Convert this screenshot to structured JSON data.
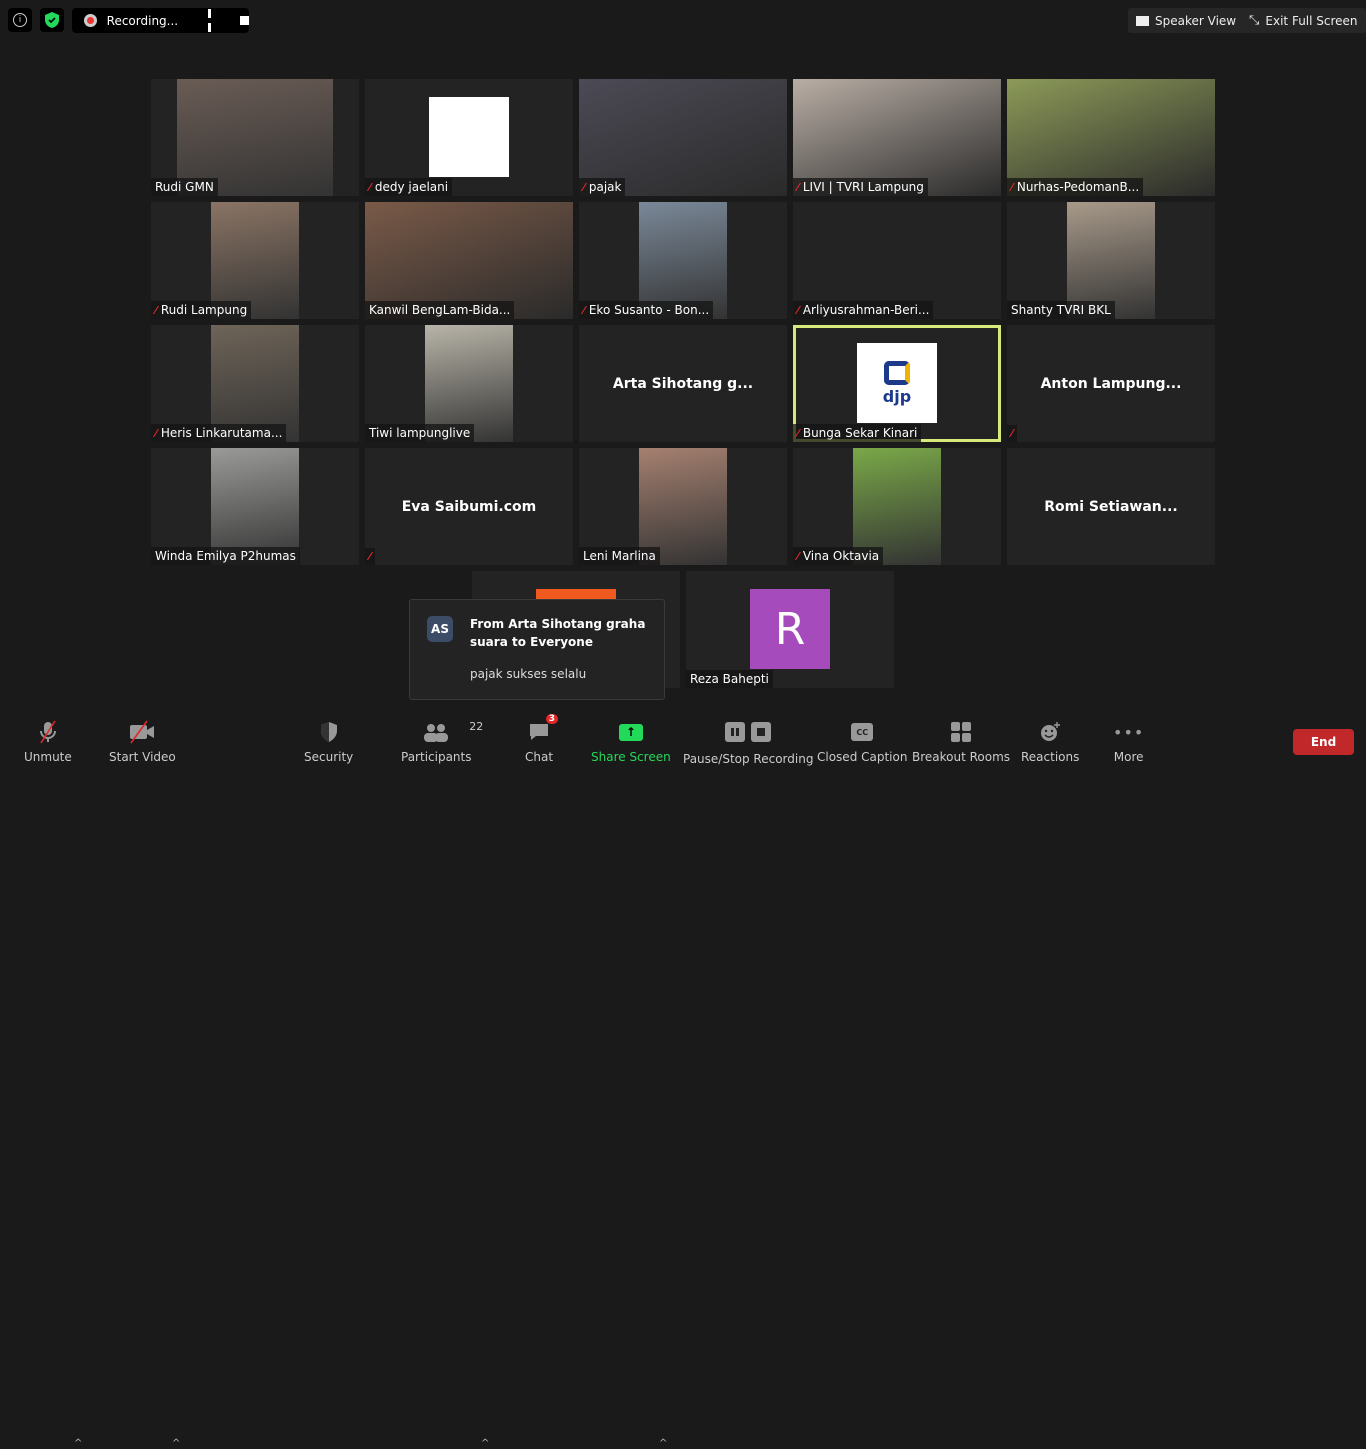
{
  "topbar": {
    "recording_label": "Recording...",
    "speaker_view": "Speaker View",
    "exit_full_screen": "Exit Full Screen"
  },
  "tiles": [
    {
      "name": "Rudi GMN",
      "muted": false,
      "kind": "inset",
      "color": "#6a5c55"
    },
    {
      "name": "dedy jaelani",
      "muted": true,
      "kind": "white"
    },
    {
      "name": "pajak",
      "muted": true,
      "kind": "full",
      "color": "#4c4a55"
    },
    {
      "name": "LIVI | TVRI Lampung",
      "muted": true,
      "kind": "full",
      "color": "#b9aea5"
    },
    {
      "name": "Nurhas-PedomanB...",
      "muted": true,
      "kind": "full",
      "color": "#8c9a58"
    },
    {
      "name": "Rudi Lampung",
      "muted": true,
      "kind": "inset",
      "color": "#8a7464"
    },
    {
      "name": "Kanwil BengLam-Bida...",
      "muted": false,
      "kind": "full",
      "color": "#7a5a48"
    },
    {
      "name": "Eko Susanto - Bon...",
      "muted": true,
      "kind": "inset",
      "color": "#7a8898"
    },
    {
      "name": "Arliyusrahman-Beri...",
      "muted": true,
      "kind": "none"
    },
    {
      "name": "Shanty TVRI BKL",
      "muted": false,
      "kind": "inset",
      "color": "#a89a8a"
    },
    {
      "name": "Heris Linkarutama...",
      "muted": true,
      "kind": "inset",
      "color": "#6e6458"
    },
    {
      "name": "Tiwi lampunglive",
      "muted": false,
      "kind": "inset",
      "color": "#b8b4a8"
    },
    {
      "name": "",
      "center": "Arta  Sihotang  g...",
      "muted": false,
      "kind": "nameonly"
    },
    {
      "name": "Bunga Sekar Kinari",
      "muted": true,
      "kind": "djp",
      "active": true
    },
    {
      "name": "",
      "center": "Anton  Lampung...",
      "muted": true,
      "kind": "nameonly"
    },
    {
      "name": "Winda Emilya P2humas",
      "muted": false,
      "kind": "inset",
      "color": "#9a9a98"
    },
    {
      "name": "",
      "center": "Eva Saibumi.com",
      "muted": true,
      "kind": "nameonly"
    },
    {
      "name": "Leni Marlina",
      "muted": false,
      "kind": "inset",
      "color": "#a58070"
    },
    {
      "name": "Vina Oktavia",
      "muted": true,
      "kind": "inset",
      "color": "#7aa848"
    },
    {
      "name": "",
      "center": "Romi  Setiawan...",
      "muted": false,
      "kind": "nameonly"
    },
    {
      "name": "",
      "muted": false,
      "kind": "orange"
    },
    {
      "name": "Reza Bahepti",
      "muted": false,
      "kind": "avatar",
      "initial": "R",
      "color": "#a54bbb"
    }
  ],
  "djp_logo": "djp",
  "chat_popup": {
    "initials": "AS",
    "from": "From Arta Sihotang graha suara to Everyone",
    "message": "pajak sukses selalu"
  },
  "toolbar": {
    "unmute": "Unmute",
    "start_video": "Start Video",
    "security": "Security",
    "participants": "Participants",
    "participants_count": "22",
    "chat": "Chat",
    "chat_badge": "3",
    "share_screen": "Share Screen",
    "pause_stop": "Pause/Stop Recording",
    "closed_caption": "Closed Caption",
    "cc_glyph": "CC",
    "breakout": "Breakout Rooms",
    "reactions": "Reactions",
    "more": "More",
    "end": "End"
  },
  "colors": {
    "share": "#23d959",
    "end": "#c0282a",
    "active_speaker": "#d8e87a",
    "muted": "#e02828"
  }
}
